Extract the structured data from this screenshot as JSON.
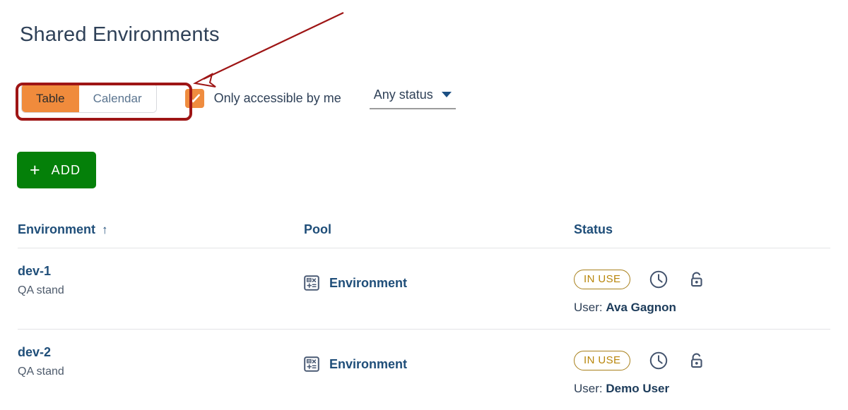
{
  "page": {
    "title": "Shared Environments"
  },
  "toolbar": {
    "view_toggle": {
      "options": [
        "Table",
        "Calendar"
      ],
      "selected": "Table"
    },
    "accessible_checkbox": {
      "label": "Only accessible by me",
      "checked": true,
      "icon": "check-icon"
    },
    "status_filter": {
      "value": "Any status",
      "icon": "chevron-down-icon"
    },
    "add_button": {
      "plus": "+",
      "label": "ADD",
      "icon": "plus-icon"
    }
  },
  "table": {
    "columns": [
      {
        "label": "Environment",
        "sort": "↑",
        "sorted": true
      },
      {
        "label": "Pool",
        "sort": "",
        "sorted": false
      },
      {
        "label": "Status",
        "sort": "",
        "sorted": false
      }
    ],
    "rows": [
      {
        "environment": "dev-1",
        "description": "QA stand",
        "pool": "Environment",
        "pool_icon": "calculator-grid-icon",
        "status_badge": "IN USE",
        "clock_icon": "clock-icon",
        "lock_icon": "unlock-icon",
        "user_label": "User:",
        "user_name": "Ava Gagnon"
      },
      {
        "environment": "dev-2",
        "description": "QA stand",
        "pool": "Environment",
        "pool_icon": "calculator-grid-icon",
        "status_badge": "IN USE",
        "clock_icon": "clock-icon",
        "lock_icon": "unlock-icon",
        "user_label": "User:",
        "user_name": "Demo User"
      }
    ]
  },
  "annotation": {
    "arrow_color": "#9e1515",
    "highlight_color": "#9e1515",
    "target": "view-toggle"
  },
  "colors": {
    "accent_orange": "#f08b3c",
    "add_green": "#048009",
    "link_blue": "#1f4e79",
    "badge_gold": "#b8860b",
    "annotation_red": "#9e1515"
  }
}
